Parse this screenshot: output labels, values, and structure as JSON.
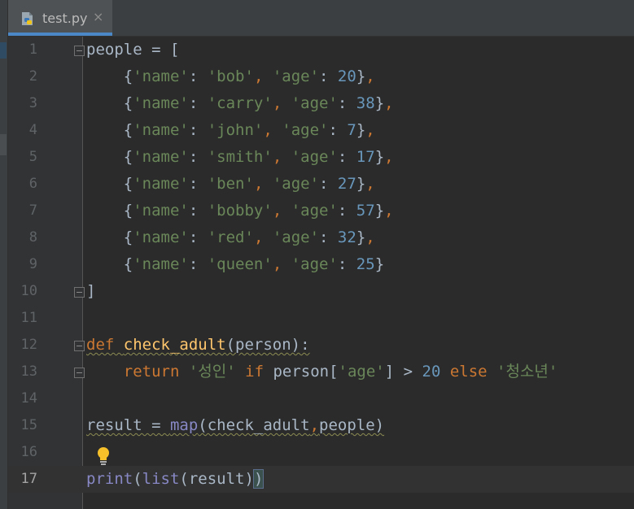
{
  "editor": {
    "tab": {
      "label": "test.py",
      "close_glyph": "×",
      "icon": "python-file-icon"
    },
    "current_line": 17,
    "line_numbers": [
      "1",
      "2",
      "3",
      "4",
      "5",
      "6",
      "7",
      "8",
      "9",
      "10",
      "11",
      "12",
      "13",
      "14",
      "15",
      "16",
      "17"
    ],
    "lines": [
      [
        {
          "t": "people = [",
          "c": "plain"
        }
      ],
      [
        {
          "t": "    {",
          "c": "plain"
        },
        {
          "t": "'name'",
          "c": "str"
        },
        {
          "t": ": ",
          "c": "plain"
        },
        {
          "t": "'bob'",
          "c": "str"
        },
        {
          "t": ", ",
          "c": "kw"
        },
        {
          "t": "'age'",
          "c": "str"
        },
        {
          "t": ": ",
          "c": "plain"
        },
        {
          "t": "20",
          "c": "num"
        },
        {
          "t": "}",
          "c": "plain"
        },
        {
          "t": ",",
          "c": "kw"
        }
      ],
      [
        {
          "t": "    {",
          "c": "plain"
        },
        {
          "t": "'name'",
          "c": "str"
        },
        {
          "t": ": ",
          "c": "plain"
        },
        {
          "t": "'carry'",
          "c": "str"
        },
        {
          "t": ", ",
          "c": "kw"
        },
        {
          "t": "'age'",
          "c": "str"
        },
        {
          "t": ": ",
          "c": "plain"
        },
        {
          "t": "38",
          "c": "num"
        },
        {
          "t": "}",
          "c": "plain"
        },
        {
          "t": ",",
          "c": "kw"
        }
      ],
      [
        {
          "t": "    {",
          "c": "plain"
        },
        {
          "t": "'name'",
          "c": "str"
        },
        {
          "t": ": ",
          "c": "plain"
        },
        {
          "t": "'john'",
          "c": "str"
        },
        {
          "t": ", ",
          "c": "kw"
        },
        {
          "t": "'age'",
          "c": "str"
        },
        {
          "t": ": ",
          "c": "plain"
        },
        {
          "t": "7",
          "c": "num"
        },
        {
          "t": "}",
          "c": "plain"
        },
        {
          "t": ",",
          "c": "kw"
        }
      ],
      [
        {
          "t": "    {",
          "c": "plain"
        },
        {
          "t": "'name'",
          "c": "str"
        },
        {
          "t": ": ",
          "c": "plain"
        },
        {
          "t": "'smith'",
          "c": "str"
        },
        {
          "t": ", ",
          "c": "kw"
        },
        {
          "t": "'age'",
          "c": "str"
        },
        {
          "t": ": ",
          "c": "plain"
        },
        {
          "t": "17",
          "c": "num"
        },
        {
          "t": "}",
          "c": "plain"
        },
        {
          "t": ",",
          "c": "kw"
        }
      ],
      [
        {
          "t": "    {",
          "c": "plain"
        },
        {
          "t": "'name'",
          "c": "str"
        },
        {
          "t": ": ",
          "c": "plain"
        },
        {
          "t": "'ben'",
          "c": "str"
        },
        {
          "t": ", ",
          "c": "kw"
        },
        {
          "t": "'age'",
          "c": "str"
        },
        {
          "t": ": ",
          "c": "plain"
        },
        {
          "t": "27",
          "c": "num"
        },
        {
          "t": "}",
          "c": "plain"
        },
        {
          "t": ",",
          "c": "kw"
        }
      ],
      [
        {
          "t": "    {",
          "c": "plain"
        },
        {
          "t": "'name'",
          "c": "str"
        },
        {
          "t": ": ",
          "c": "plain"
        },
        {
          "t": "'bobby'",
          "c": "str"
        },
        {
          "t": ", ",
          "c": "kw"
        },
        {
          "t": "'age'",
          "c": "str"
        },
        {
          "t": ": ",
          "c": "plain"
        },
        {
          "t": "57",
          "c": "num"
        },
        {
          "t": "}",
          "c": "plain"
        },
        {
          "t": ",",
          "c": "kw"
        }
      ],
      [
        {
          "t": "    {",
          "c": "plain"
        },
        {
          "t": "'name'",
          "c": "str"
        },
        {
          "t": ": ",
          "c": "plain"
        },
        {
          "t": "'red'",
          "c": "str"
        },
        {
          "t": ", ",
          "c": "kw"
        },
        {
          "t": "'age'",
          "c": "str"
        },
        {
          "t": ": ",
          "c": "plain"
        },
        {
          "t": "32",
          "c": "num"
        },
        {
          "t": "}",
          "c": "plain"
        },
        {
          "t": ",",
          "c": "kw"
        }
      ],
      [
        {
          "t": "    {",
          "c": "plain"
        },
        {
          "t": "'name'",
          "c": "str"
        },
        {
          "t": ": ",
          "c": "plain"
        },
        {
          "t": "'queen'",
          "c": "str"
        },
        {
          "t": ", ",
          "c": "kw"
        },
        {
          "t": "'age'",
          "c": "str"
        },
        {
          "t": ": ",
          "c": "plain"
        },
        {
          "t": "25",
          "c": "num"
        },
        {
          "t": "}",
          "c": "plain"
        }
      ],
      [
        {
          "t": "]",
          "c": "plain"
        }
      ],
      [],
      [
        {
          "t": "def ",
          "c": "kw squig"
        },
        {
          "t": "check_adult",
          "c": "fn squig"
        },
        {
          "t": "(person):",
          "c": "plain squig"
        }
      ],
      [
        {
          "t": "    return ",
          "c": "kw"
        },
        {
          "t": "'성인'",
          "c": "str"
        },
        {
          "t": " if ",
          "c": "kw"
        },
        {
          "t": "person[",
          "c": "plain"
        },
        {
          "t": "'age'",
          "c": "str"
        },
        {
          "t": "] > ",
          "c": "plain"
        },
        {
          "t": "20",
          "c": "num"
        },
        {
          "t": " else ",
          "c": "kw"
        },
        {
          "t": "'청소년'",
          "c": "str"
        }
      ],
      [],
      [
        {
          "t": "result = ",
          "c": "plain squig"
        },
        {
          "t": "map",
          "c": "bi squig"
        },
        {
          "t": "(check_adult",
          "c": "plain squig"
        },
        {
          "t": ",",
          "c": "kw squig"
        },
        {
          "t": "people)",
          "c": "plain squig"
        }
      ],
      [],
      [
        {
          "t": "print",
          "c": "bi"
        },
        {
          "t": "(",
          "c": "plain"
        },
        {
          "t": "list",
          "c": "bi"
        },
        {
          "t": "(result)",
          "c": "plain"
        },
        {
          "t": ")",
          "c": "plain match-paren"
        }
      ]
    ],
    "fold_markers": [
      1,
      10,
      12,
      13
    ],
    "intention_icon": "lightbulb-icon"
  },
  "colors": {
    "background": "#2b2b2b",
    "keyword": "#cc7832",
    "string": "#6a8759",
    "number": "#6897bb",
    "function": "#ffc66d",
    "builtin": "#8888c6",
    "plain": "#a9b7c6",
    "tab_accent": "#4a88c7"
  }
}
